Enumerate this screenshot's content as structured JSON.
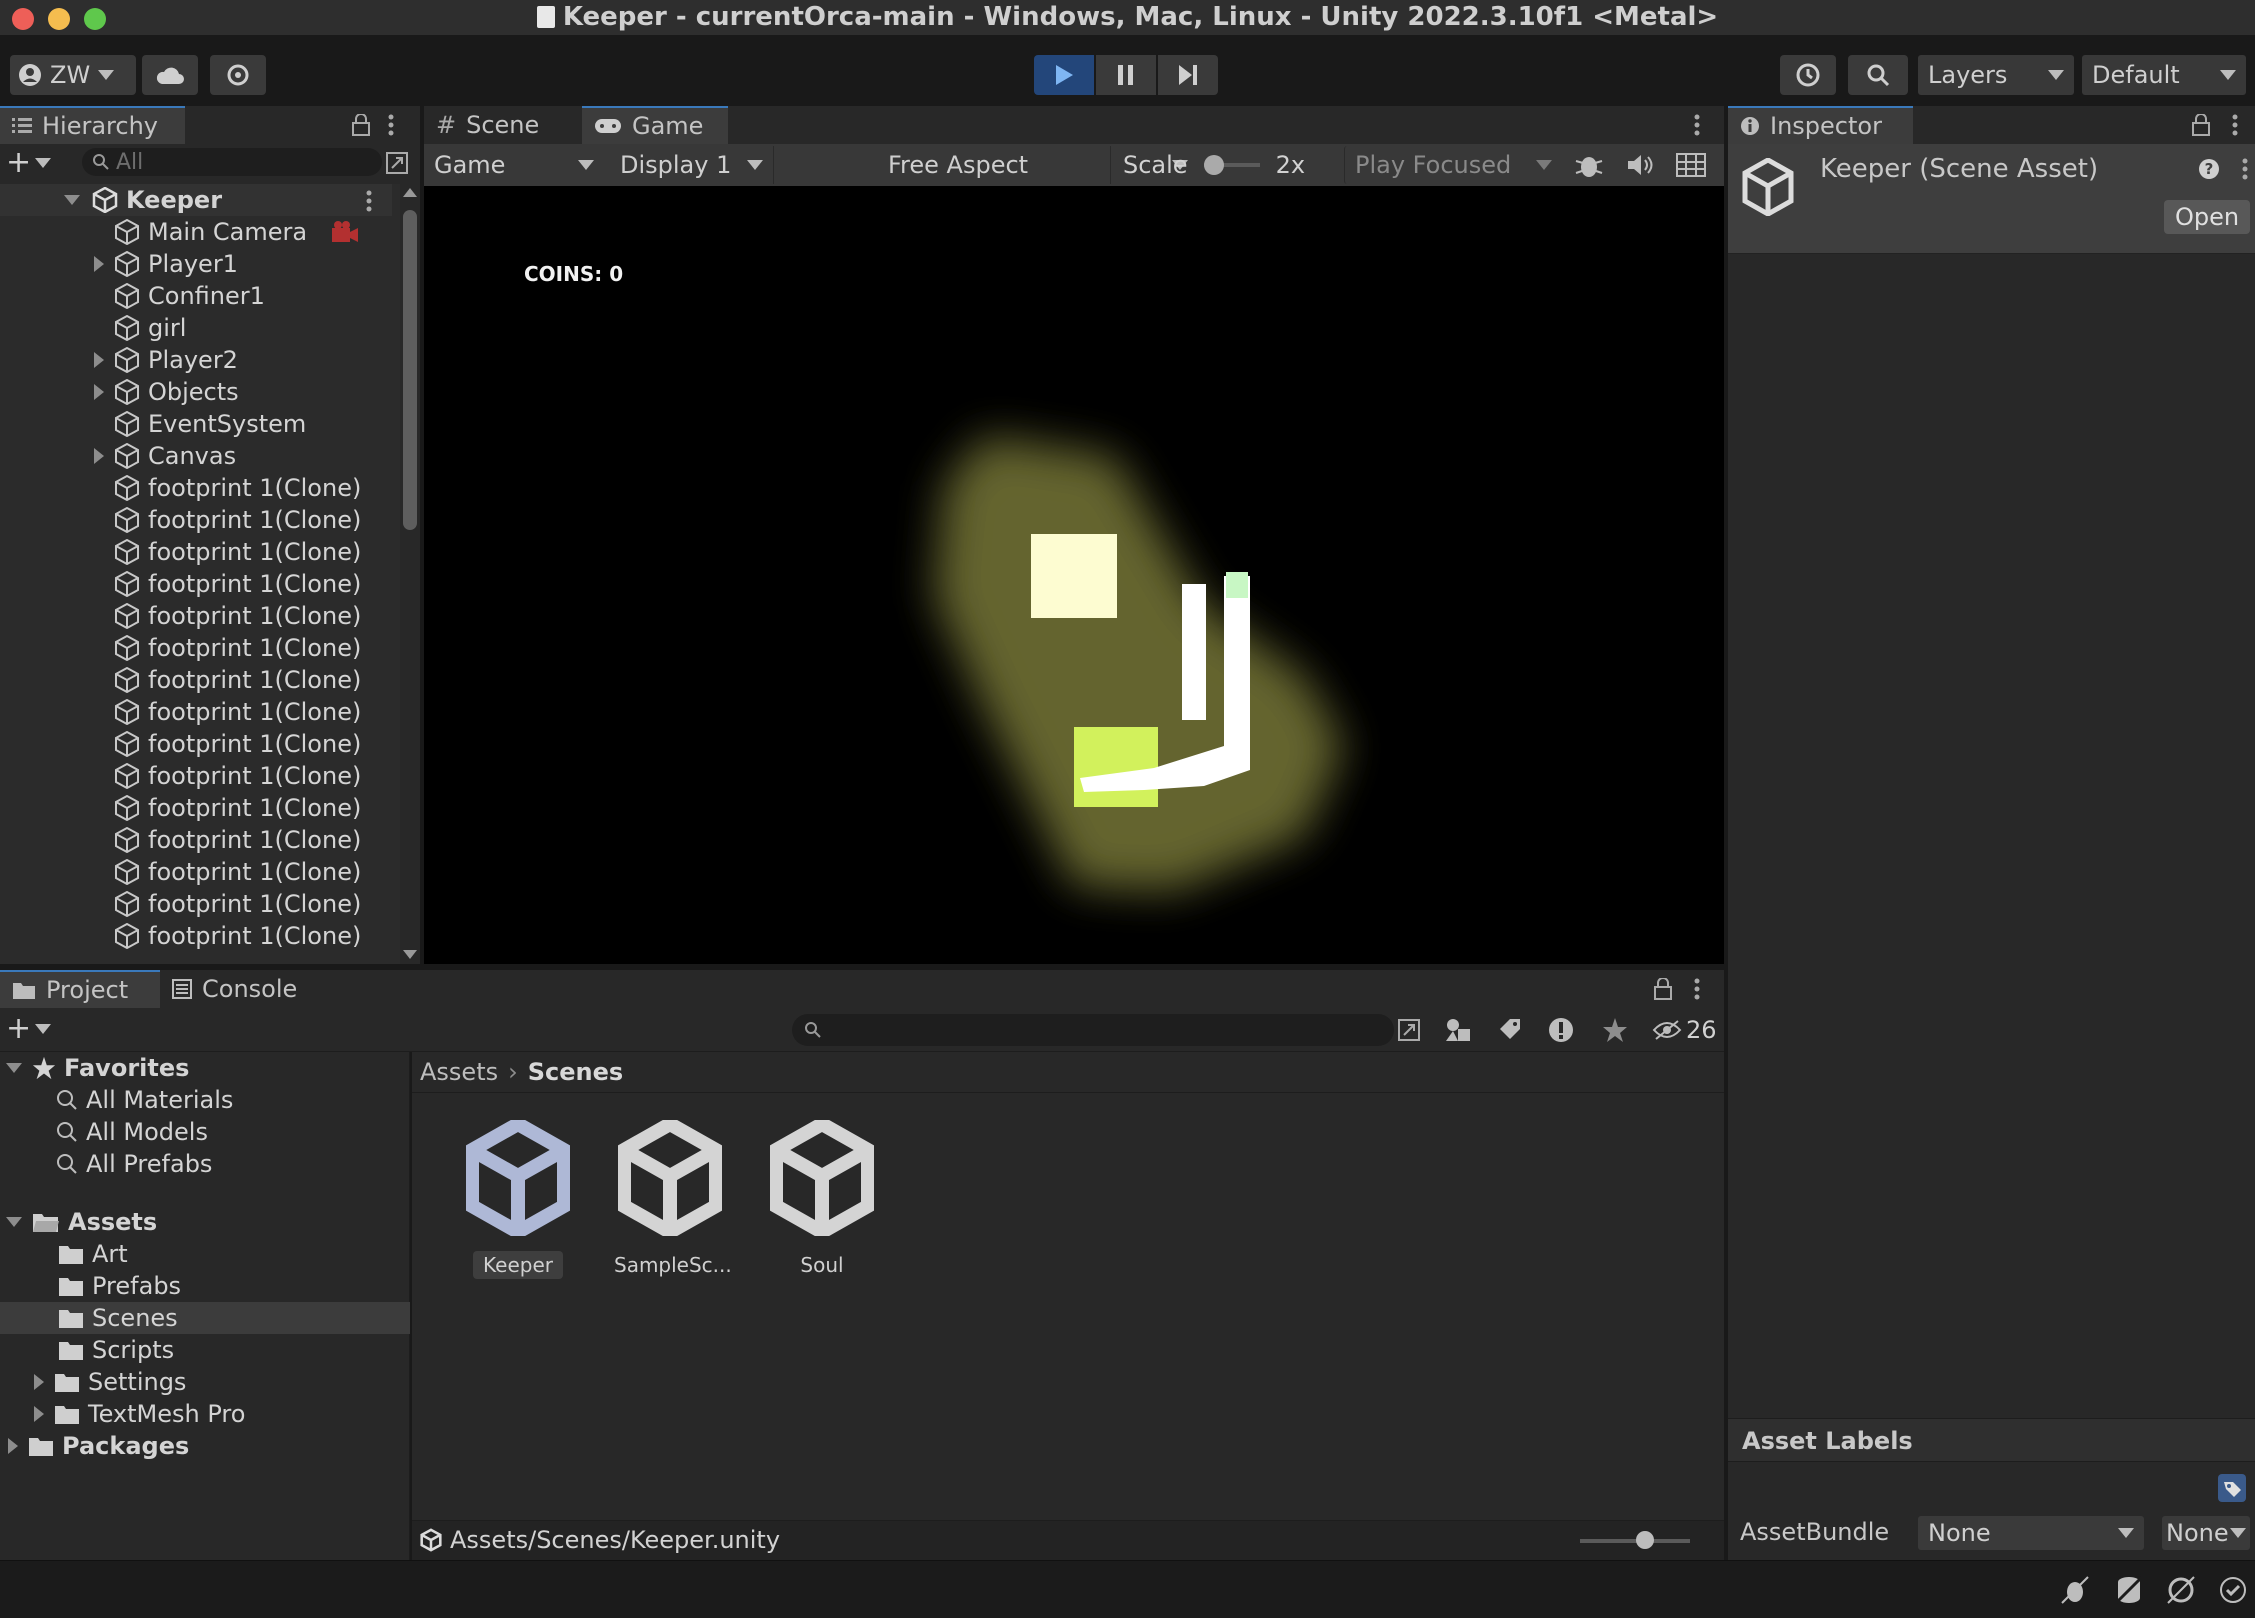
{
  "window": {
    "title": "Keeper - currentOrca-main - Windows, Mac, Linux - Unity 2022.3.10f1 <Metal>"
  },
  "toolbar": {
    "account_label": "ZW",
    "layers_label": "Layers",
    "layout_label": "Default"
  },
  "hierarchy": {
    "tab_label": "Hierarchy",
    "search_placeholder": "All",
    "root": "Keeper",
    "items": [
      {
        "label": "Main Camera",
        "expandable": false
      },
      {
        "label": "Player1",
        "expandable": true
      },
      {
        "label": "Confiner1",
        "expandable": false
      },
      {
        "label": "girl",
        "expandable": false
      },
      {
        "label": "Player2",
        "expandable": true
      },
      {
        "label": "Objects",
        "expandable": true
      },
      {
        "label": "EventSystem",
        "expandable": false
      },
      {
        "label": "Canvas",
        "expandable": true
      },
      {
        "label": "footprint 1(Clone)",
        "expandable": false
      },
      {
        "label": "footprint 1(Clone)",
        "expandable": false
      },
      {
        "label": "footprint 1(Clone)",
        "expandable": false
      },
      {
        "label": "footprint 1(Clone)",
        "expandable": false
      },
      {
        "label": "footprint 1(Clone)",
        "expandable": false
      },
      {
        "label": "footprint 1(Clone)",
        "expandable": false
      },
      {
        "label": "footprint 1(Clone)",
        "expandable": false
      },
      {
        "label": "footprint 1(Clone)",
        "expandable": false
      },
      {
        "label": "footprint 1(Clone)",
        "expandable": false
      },
      {
        "label": "footprint 1(Clone)",
        "expandable": false
      },
      {
        "label": "footprint 1(Clone)",
        "expandable": false
      },
      {
        "label": "footprint 1(Clone)",
        "expandable": false
      },
      {
        "label": "footprint 1(Clone)",
        "expandable": false
      },
      {
        "label": "footprint 1(Clone)",
        "expandable": false
      },
      {
        "label": "footprint 1(Clone)",
        "expandable": false
      }
    ]
  },
  "game_view": {
    "tabs": [
      {
        "label": "Scene"
      },
      {
        "label": "Game"
      }
    ],
    "display_mode": "Game",
    "display": "Display 1",
    "aspect": "Free Aspect",
    "scale_label": "Scale",
    "scale_value": "2x",
    "play_mode": "Play Focused",
    "hud_coins": "COINS: 0"
  },
  "inspector": {
    "tab_label": "Inspector",
    "asset_name": "Keeper (Scene Asset)",
    "open_button": "Open",
    "asset_labels_title": "Asset Labels",
    "assetbundle_label": "AssetBundle",
    "assetbundle_value": "None",
    "assetbundle_variant": "None"
  },
  "project": {
    "tabs": [
      {
        "label": "Project"
      },
      {
        "label": "Console"
      }
    ],
    "hidden_count": "26",
    "favorites": {
      "label": "Favorites",
      "items": [
        "All Materials",
        "All Models",
        "All Prefabs"
      ]
    },
    "assets": {
      "label": "Assets",
      "items": [
        {
          "label": "Art",
          "expandable": false
        },
        {
          "label": "Prefabs",
          "expandable": false
        },
        {
          "label": "Scenes",
          "expandable": false,
          "selected": true
        },
        {
          "label": "Scripts",
          "expandable": false
        },
        {
          "label": "Settings",
          "expandable": true
        },
        {
          "label": "TextMesh Pro",
          "expandable": true
        }
      ]
    },
    "packages_label": "Packages",
    "breadcrumb": [
      "Assets",
      "Scenes"
    ],
    "files": [
      {
        "label": "Keeper",
        "selected": true
      },
      {
        "label": "SampleSc...",
        "selected": false
      },
      {
        "label": "Soul",
        "selected": false
      }
    ],
    "path": "Assets/Scenes/Keeper.unity"
  },
  "colors": {
    "accent": "#3a79bb",
    "play_active": "#23467a",
    "panel": "#282828",
    "dark": "#191919"
  }
}
